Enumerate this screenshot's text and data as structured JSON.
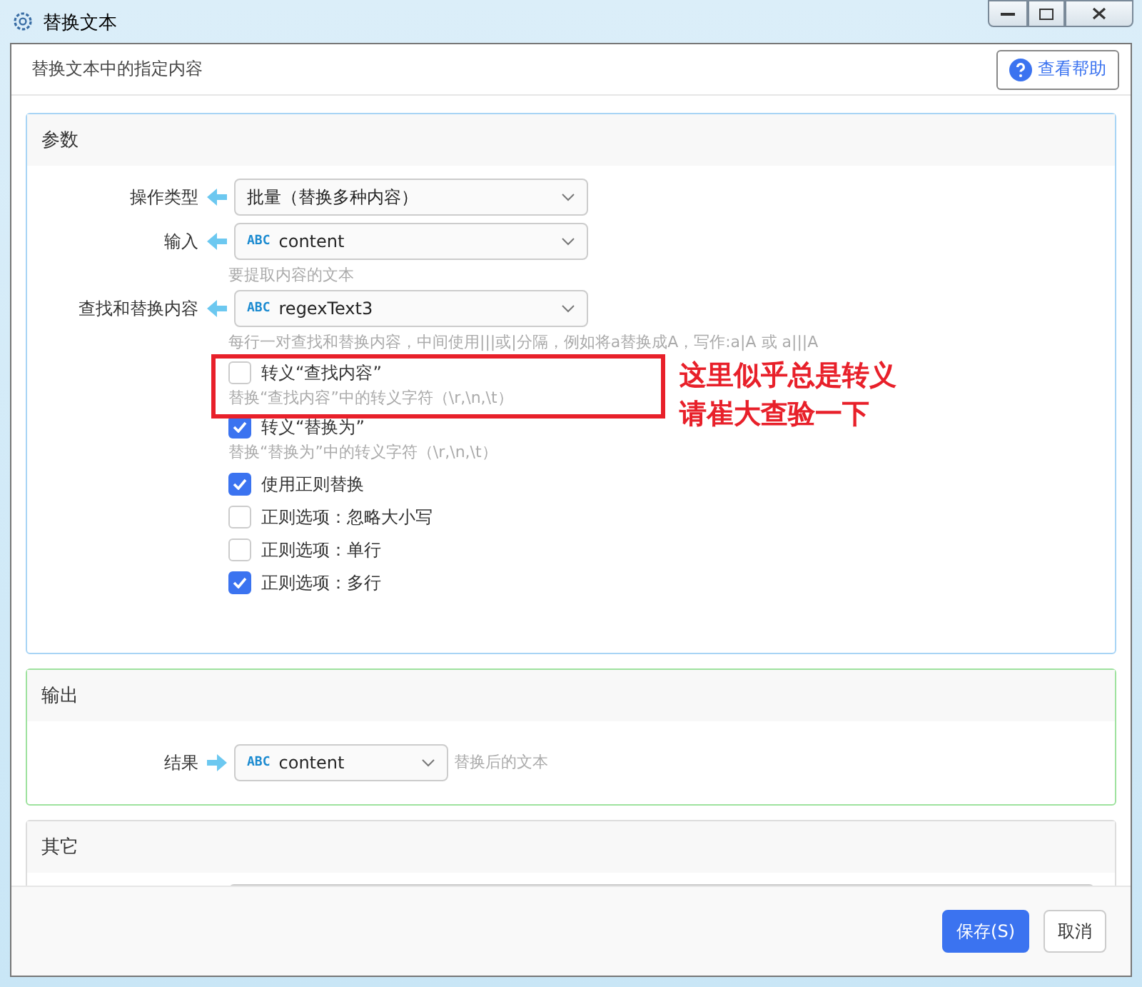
{
  "window": {
    "title": "替换文本"
  },
  "header": {
    "description": "替换文本中的指定内容",
    "help_button": "查看帮助"
  },
  "parameters": {
    "title": "参数",
    "fields": [
      {
        "label": "操作类型",
        "kind": "input",
        "value": "批量（替换多种内容）"
      },
      {
        "label": "输入",
        "kind": "input",
        "type_badge": "ABC",
        "value": "content",
        "hint": "要提取内容的文本"
      },
      {
        "label": "查找和替换内容",
        "kind": "input",
        "type_badge": "ABC",
        "value": "regexText3",
        "hint": "每行一对查找和替换内容，中间使用|||或|分隔，例如将a替换成A，写作:a|A 或 a|||A"
      }
    ],
    "options": [
      {
        "label": "转义“查找内容”",
        "checked": false,
        "hint": "替换“查找内容”中的转义字符（\\r,\\n,\\t）"
      },
      {
        "label": "转义“替换为”",
        "checked": true,
        "hint": "替换“替换为”中的转义字符（\\r,\\n,\\t）"
      },
      {
        "label": "使用正则替换",
        "checked": true
      },
      {
        "label": "正则选项：忽略大小写",
        "checked": false
      },
      {
        "label": "正则选项：单行",
        "checked": false
      },
      {
        "label": "正则选项：多行",
        "checked": true
      }
    ]
  },
  "annotation": {
    "lines": [
      "这里似乎总是转义",
      "请崔大查验一下"
    ]
  },
  "output": {
    "title": "输出",
    "fields": [
      {
        "label": "结果",
        "kind": "output",
        "type_badge": "ABC",
        "value": "content",
        "hint": "替换后的文本"
      }
    ]
  },
  "other": {
    "title": "其它"
  },
  "footer": {
    "buttons": [
      {
        "label": "保存(S)",
        "kind": "primary"
      },
      {
        "label": "取消",
        "kind": "default"
      }
    ]
  }
}
